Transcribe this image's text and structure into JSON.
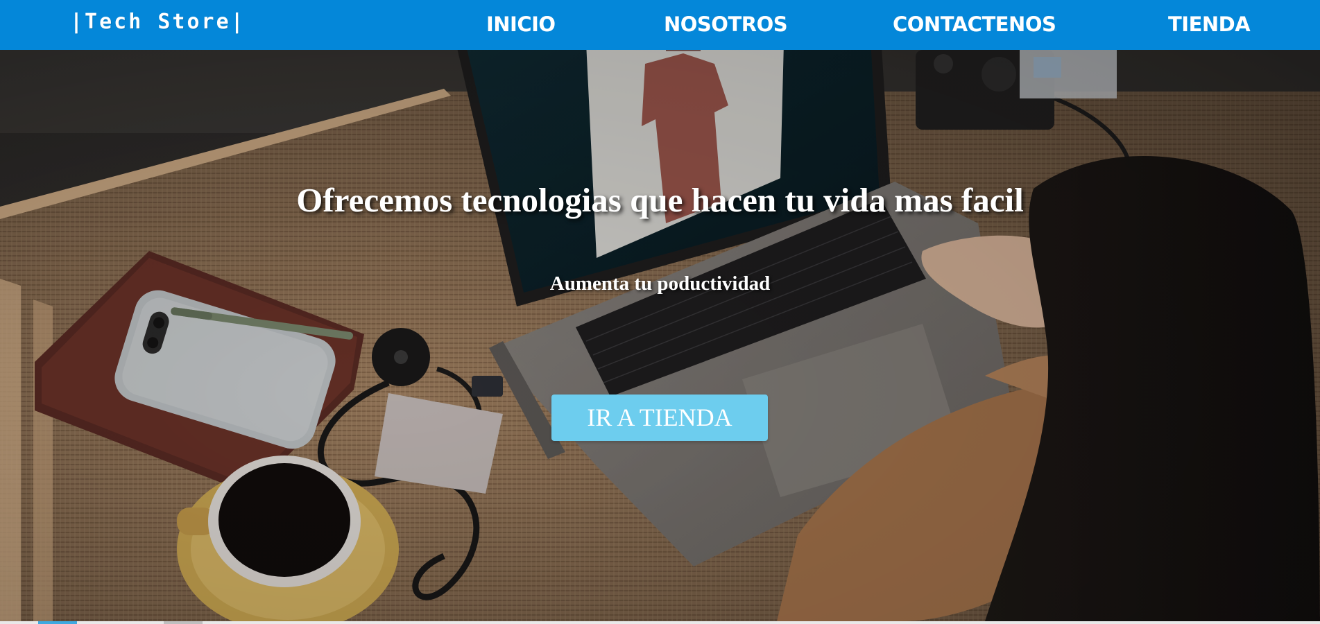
{
  "navbar": {
    "logo": "|Tech Store|",
    "links": [
      {
        "label": "INICIO"
      },
      {
        "label": "NOSOTROS"
      },
      {
        "label": "CONTACTENOS"
      },
      {
        "label": "TIENDA"
      }
    ],
    "background_color": "#0487d9",
    "text_color": "#ffffff"
  },
  "hero": {
    "title": "Ofrecemos tecnologias que hacen tu vida mas facil",
    "subtitle": "Aumenta tu poductividad",
    "cta_label": "IR A TIENDA",
    "cta_color": "#6dcdee",
    "background_image": "photo of a person typing on a laptop on a woven rattan desk with a phone, notebook, pen, coffee cup, tape measure and camera"
  }
}
